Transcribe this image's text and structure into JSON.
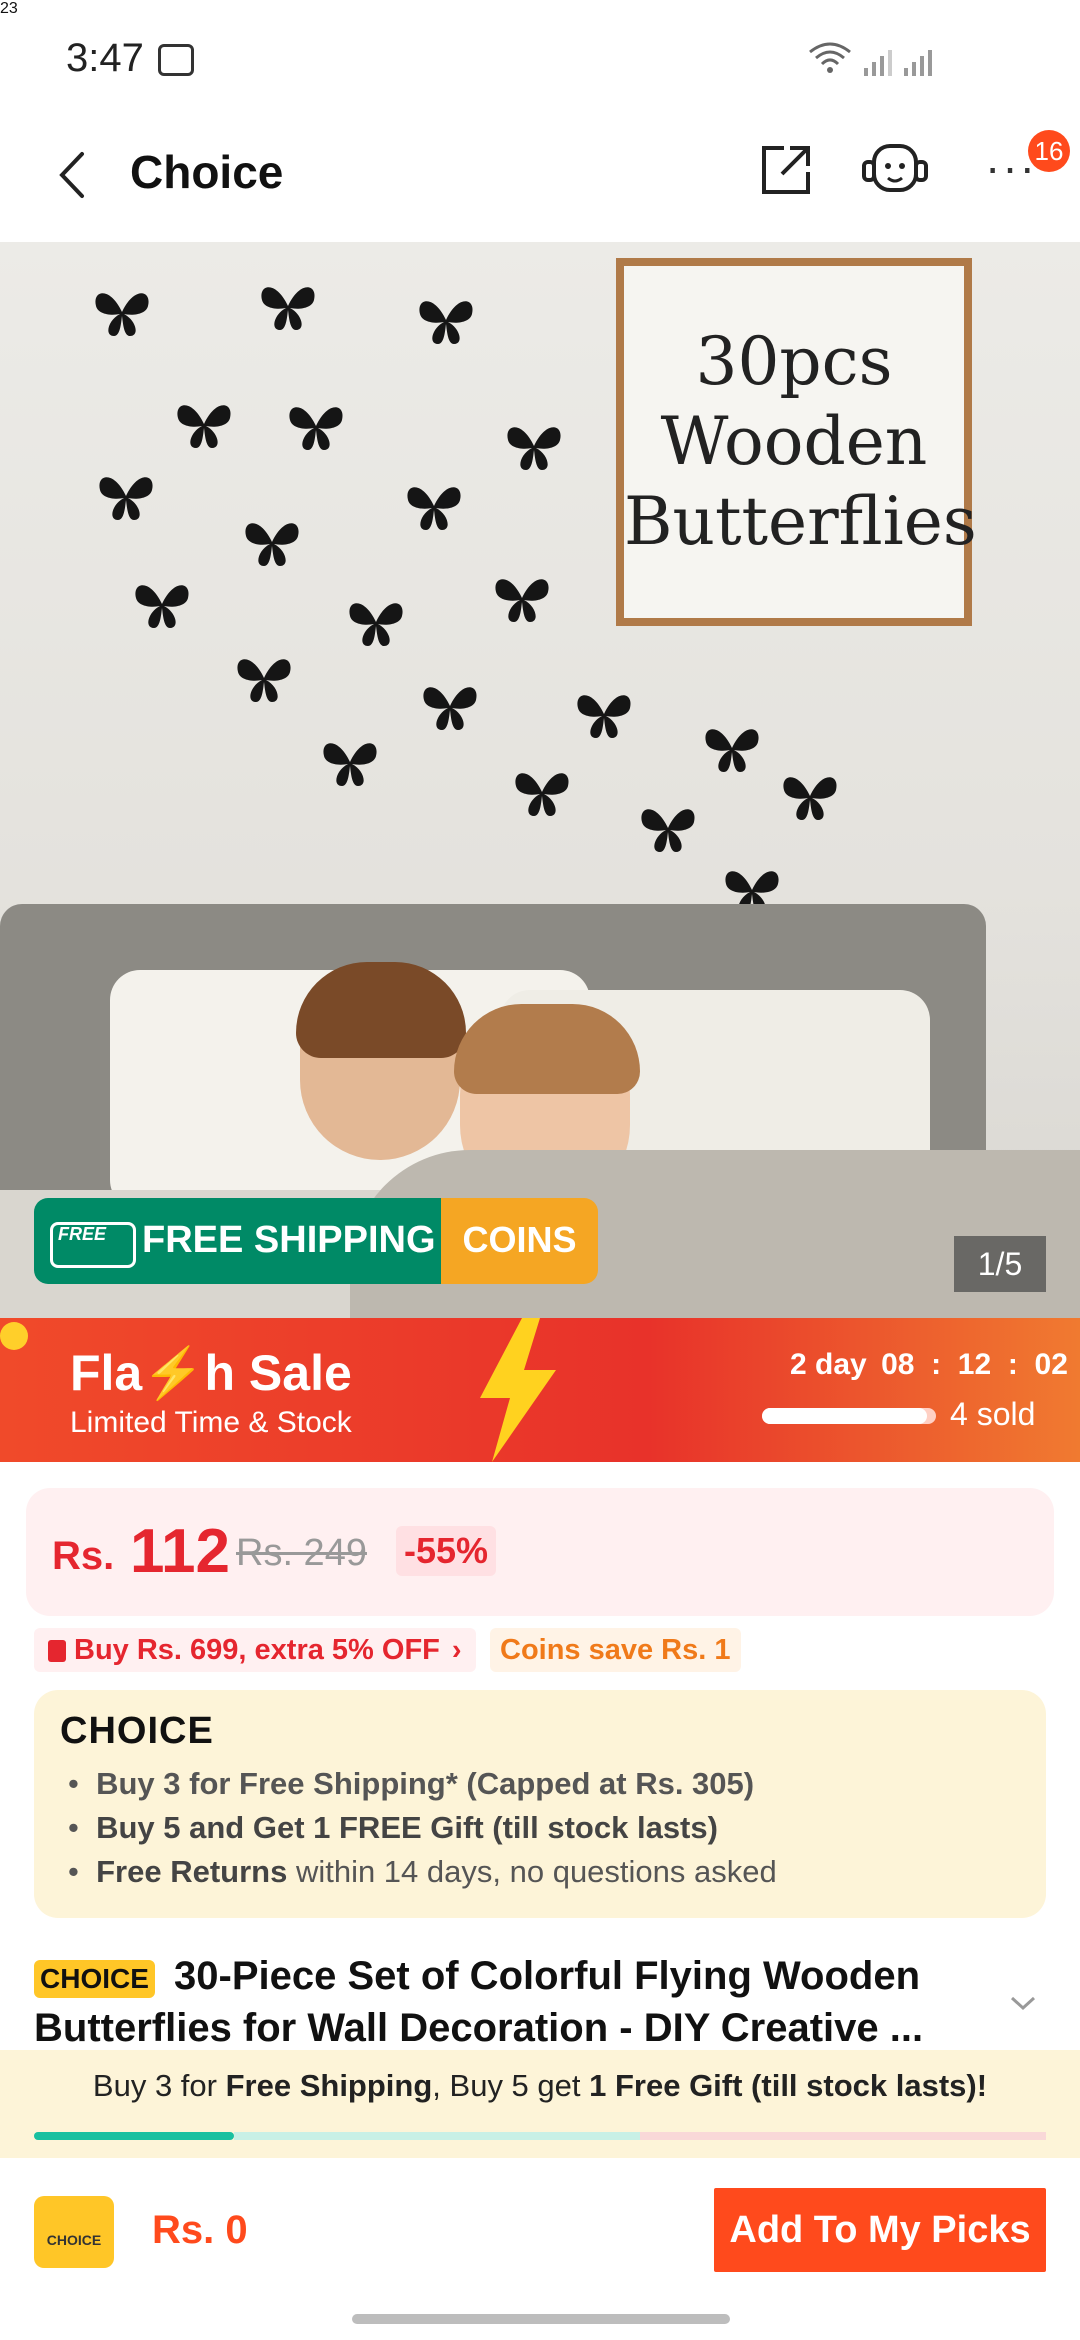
{
  "status_bar": {
    "time": "3:47",
    "battery": "23"
  },
  "header": {
    "back_icon": "chevron-left-icon",
    "title": "Choice",
    "share_icon": "share-icon",
    "service_icon": "customer-service-icon",
    "more_icon": "more-icon",
    "more_label": "···",
    "notification_count": "16"
  },
  "hero": {
    "frame_lines": [
      "30pcs",
      "Wooden",
      "Butterflies"
    ],
    "shipping_badge": {
      "truck_label": "FREE",
      "label": "FREE SHIPPING",
      "coins_label": "COINS"
    },
    "image_counter": "1/5"
  },
  "flash_sale": {
    "title": "Fla⚡h Sale",
    "subtitle": "Limited Time & Stock",
    "countdown_days": "2 day",
    "hours": "08",
    "minutes": "12",
    "seconds": "02",
    "sold": "4 sold",
    "sold_progress": 0.95
  },
  "price": {
    "currency": "Rs.",
    "value": "112",
    "original": "Rs. 249",
    "discount": "-55%"
  },
  "promos": {
    "extra_off": "Buy Rs. 699, extra 5% OFF",
    "coins": "Coins save Rs. 1"
  },
  "choice": {
    "logo": "CHOICE",
    "bullets": [
      {
        "bold": "",
        "text": "Buy 3 for  Free Shipping* (Capped at Rs. 305)"
      },
      {
        "bold": "Buy 5 and Get 1 FREE Gift (till stock lasts)",
        "text": ""
      },
      {
        "bold": "Free Returns",
        "text": " within 14 days, no questions asked"
      }
    ]
  },
  "product": {
    "tag": "CHOICE",
    "title": "30-Piece Set of Colorful Flying Wooden Butterflies for Wall Decoration - DIY Creative ..."
  },
  "banner": {
    "p1": "Buy 3 for ",
    "b1": "Free Shipping",
    "p2": ", Buy 5 get ",
    "b2": "1 Free Gift (till stock lasts)!"
  },
  "bottom": {
    "cart_label": "CHOICE",
    "picks_value": "Rs. 0",
    "add_button": "Add To My Picks"
  },
  "colors": {
    "accent": "#ff4a1c",
    "price": "#e5262f",
    "shipping_green": "#008a66",
    "coins_orange": "#f5a623",
    "choice_yellow": "#ffc627"
  }
}
